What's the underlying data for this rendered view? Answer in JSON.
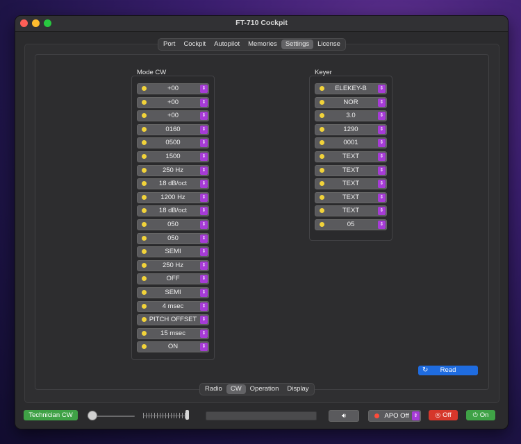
{
  "window": {
    "title": "FT-710 Cockpit"
  },
  "tabs_top": [
    {
      "label": "Port",
      "active": false
    },
    {
      "label": "Cockpit",
      "active": false
    },
    {
      "label": "Autopilot",
      "active": false
    },
    {
      "label": "Memories",
      "active": false
    },
    {
      "label": "Settings",
      "active": true
    },
    {
      "label": "License",
      "active": false
    }
  ],
  "tabs_bottom": [
    {
      "label": "Radio",
      "active": false
    },
    {
      "label": "CW",
      "active": true
    },
    {
      "label": "Operation",
      "active": false
    },
    {
      "label": "Display",
      "active": false
    }
  ],
  "mode_cw": {
    "label": "Mode CW",
    "values": [
      "+00",
      "+00",
      "+00",
      "0160",
      "0500",
      "1500",
      "250 Hz",
      "18 dB/oct",
      "1200 Hz",
      "18 dB/oct",
      "050",
      "050",
      "SEMI",
      "250 Hz",
      "OFF",
      "SEMI",
      "4 msec",
      "PITCH OFFSET",
      "15 msec",
      "ON"
    ]
  },
  "keyer": {
    "label": "Keyer",
    "values": [
      "ELEKEY-B",
      "NOR",
      "3.0",
      "1290",
      "0001",
      "TEXT",
      "TEXT",
      "TEXT",
      "TEXT",
      "TEXT",
      "05"
    ]
  },
  "read_button": {
    "label": "Read",
    "icon": "refresh-icon"
  },
  "status_bar": {
    "license_label": "Technician CW",
    "speaker_icon": "speaker-icon",
    "apo_label": "APO Off",
    "off_label": "Off",
    "on_label": "On"
  },
  "colors": {
    "accent": "#a63bd6",
    "dot": "#f2d33a",
    "read": "#1f6ce0",
    "green": "#3fa246",
    "red": "#d6372b"
  }
}
